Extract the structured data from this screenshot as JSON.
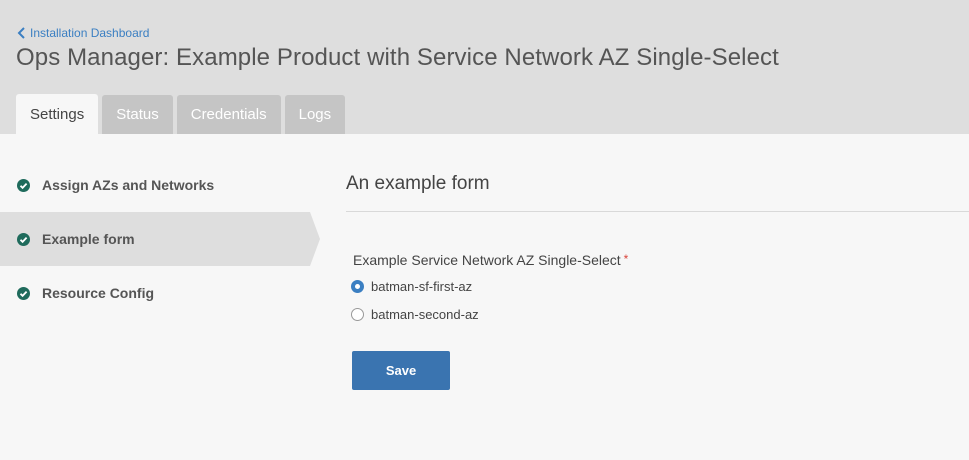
{
  "header": {
    "back_link": "Installation Dashboard",
    "title": "Ops Manager: Example Product with Service Network AZ Single-Select",
    "tabs": [
      {
        "label": "Settings",
        "active": true
      },
      {
        "label": "Status",
        "active": false
      },
      {
        "label": "Credentials",
        "active": false
      },
      {
        "label": "Logs",
        "active": false
      }
    ]
  },
  "sidebar": {
    "items": [
      {
        "label": "Assign AZs and Networks",
        "icon": "check-circle-icon",
        "active": false
      },
      {
        "label": "Example form",
        "icon": "check-circle-icon",
        "active": true
      },
      {
        "label": "Resource Config",
        "icon": "check-circle-icon",
        "active": false
      }
    ]
  },
  "form": {
    "title": "An example form",
    "field_label": "Example Service Network AZ Single-Select",
    "required_marker": "*",
    "options": [
      {
        "label": "batman-sf-first-az",
        "selected": true
      },
      {
        "label": "batman-second-az",
        "selected": false
      }
    ],
    "save_label": "Save"
  },
  "colors": {
    "link": "#3b7fc2",
    "check": "#1f6b5c",
    "primary_button": "#3a74b0",
    "required": "#d9433a",
    "header_bg": "#dedede",
    "tab_inactive": "#c5c5c5"
  }
}
